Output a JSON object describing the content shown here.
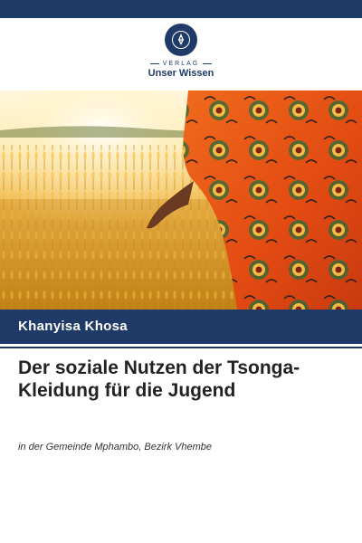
{
  "publisher": {
    "tagline": "VERLAG",
    "name": "Unser Wissen",
    "logo_icon": "book-pen-emblem-icon"
  },
  "cover_image": {
    "description_icon": "wheat-field-with-traditional-dress-photo"
  },
  "book": {
    "author": "Khanyisa Khosa",
    "title": "Der soziale Nutzen der Tsonga-Kleidung für die Jugend",
    "subtitle": "in der Gemeinde Mphambo, Bezirk Vhembe"
  },
  "colors": {
    "brand_navy": "#1f3a66",
    "title_text": "#222222",
    "background": "#ffffff"
  }
}
